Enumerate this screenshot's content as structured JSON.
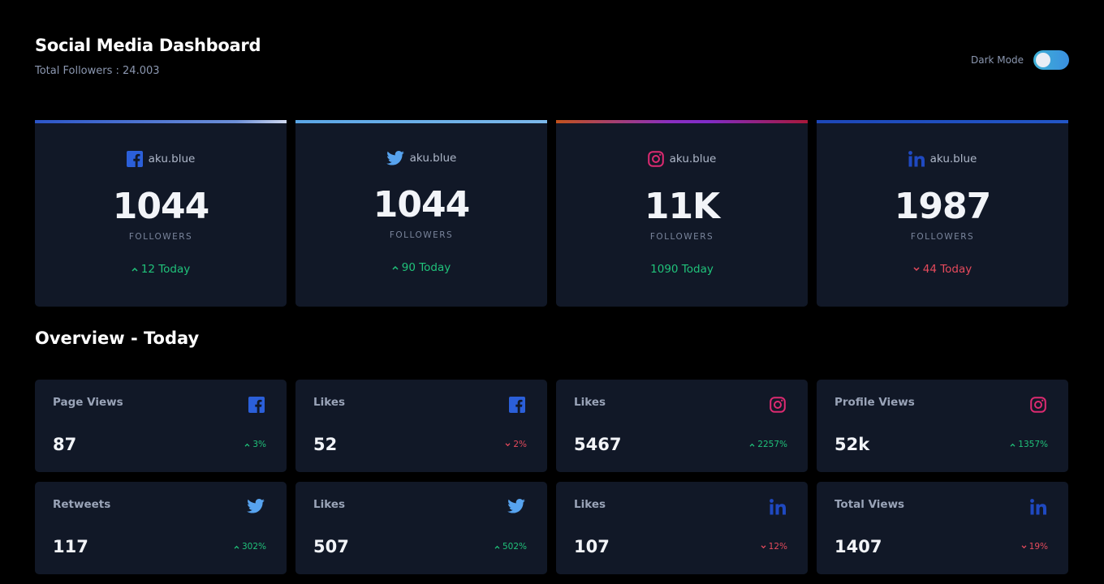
{
  "header": {
    "title": "Social Media Dashboard",
    "total_followers": "Total Followers : 24.003",
    "dark_mode_label": "Dark Mode",
    "dark_mode_on": true
  },
  "colors": {
    "facebook": "#2b5fd9",
    "twitter": "#57a3ef",
    "instagram": "#dd2a71",
    "linkedin": "#1f49c1",
    "up": "#20c27a",
    "down": "#e64a5c",
    "card_bg": "#111827",
    "page_bg": "#000000"
  },
  "followers_label": "FOLLOWERS",
  "cards": [
    {
      "network": "facebook",
      "icon": "facebook-icon",
      "handle": "aku.blue",
      "count": "1044",
      "delta": "12 Today",
      "trend": "up"
    },
    {
      "network": "twitter",
      "icon": "twitter-icon",
      "handle": "aku.blue",
      "count": "1044",
      "delta": "90 Today",
      "trend": "up"
    },
    {
      "network": "instagram",
      "icon": "instagram-icon",
      "handle": "aku.blue",
      "count": "11K",
      "delta": "1090 Today",
      "trend": "none"
    },
    {
      "network": "linkedin",
      "icon": "linkedin-icon",
      "handle": "aku.blue",
      "count": "1987",
      "delta": "44 Today",
      "trend": "down"
    }
  ],
  "overview": {
    "title": "Overview - Today",
    "tiles": [
      {
        "label": "Page Views",
        "icon": "facebook-icon",
        "value": "87",
        "delta": "3%",
        "trend": "up"
      },
      {
        "label": "Likes",
        "icon": "facebook-icon",
        "value": "52",
        "delta": "2%",
        "trend": "down"
      },
      {
        "label": "Likes",
        "icon": "instagram-icon",
        "value": "5467",
        "delta": "2257%",
        "trend": "up"
      },
      {
        "label": "Profile Views",
        "icon": "instagram-icon",
        "value": "52k",
        "delta": "1357%",
        "trend": "up"
      },
      {
        "label": "Retweets",
        "icon": "twitter-icon",
        "value": "117",
        "delta": "302%",
        "trend": "up"
      },
      {
        "label": "Likes",
        "icon": "twitter-icon",
        "value": "507",
        "delta": "502%",
        "trend": "up"
      },
      {
        "label": "Likes",
        "icon": "linkedin-icon",
        "value": "107",
        "delta": "12%",
        "trend": "down"
      },
      {
        "label": "Total Views",
        "icon": "linkedin-icon",
        "value": "1407",
        "delta": "19%",
        "trend": "down"
      }
    ]
  }
}
